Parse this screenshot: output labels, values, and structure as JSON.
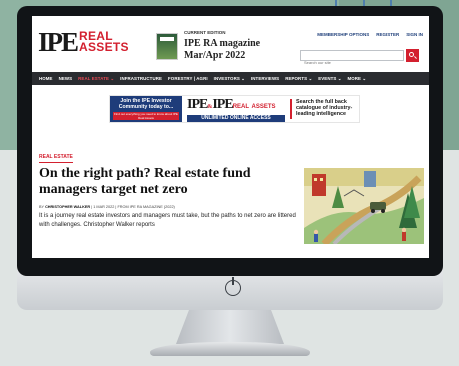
{
  "site": {
    "logo_ipe": "IPE",
    "logo_real": "REAL",
    "logo_assets": "ASSETS",
    "edition_label": "CURRENT EDITION",
    "edition_title": "IPE RA magazine",
    "edition_issue": "Mar/Apr 2022",
    "top_links": [
      "MEMBERSHIP OPTIONS",
      "REGISTER",
      "SIGN IN"
    ],
    "search_placeholder": "Search our site"
  },
  "nav": {
    "items": [
      "HOME",
      "NEWS",
      "REAL ESTATE ⌄",
      "INFRASTRUCTURE",
      "FORESTRY | AGRI",
      "INVESTORS ⌄",
      "INTERVIEWS",
      "REPORTS ⌄",
      "EVENTS ⌄",
      "MORE ⌄"
    ],
    "active_index": 2
  },
  "banner": {
    "left_title": "Join the IPE Investor Community today to...",
    "left_sub": "Find out everything you need to know about IPE Real Assets",
    "mid_logo_1": "IPE",
    "mid_amp": "&",
    "mid_logo_2": "IPE",
    "mid_real": "REAL",
    "mid_assets": "ASSETS",
    "mid_cta": "UNLIMITED ONLINE ACCESS",
    "right_text": "Search the full back catalogue of industry-leading intelligence"
  },
  "article": {
    "section": "REAL ESTATE",
    "headline": "On the right path? Real estate fund managers target net zero",
    "byline_prefix": "BY ",
    "author": "CHRISTOPHER WALKER",
    "byline_rest": " | 1 MAR 2022 | FROM IPE RA MAGAZINE (2022)",
    "standfirst": "It is a journey real estate investors and managers must take, but the paths to net zero are littered with challenges. Christopher Walker reports"
  },
  "colors": {
    "brand_red": "#d3202f",
    "brand_navy": "#1e3c7a",
    "nav_bg": "#2a2c30"
  }
}
